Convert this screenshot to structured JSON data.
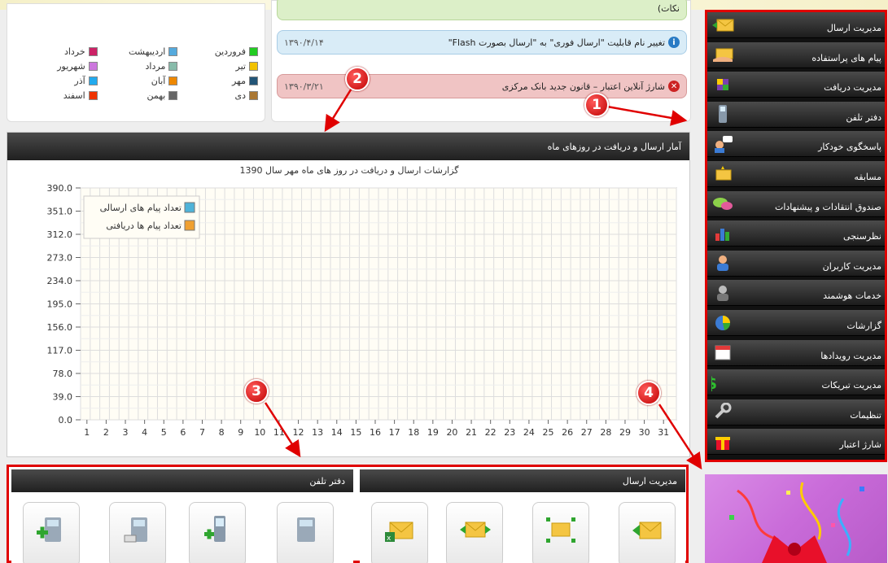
{
  "news": {
    "first_partial": "نکات)",
    "item1_text": "تغییر نام قابلیت \"ارسال فوری\" به \"ارسال بصورت Flash\"",
    "item1_date": "۱۳۹۰/۴/۱۴",
    "item2_text": "شارژ آنلاین اعتبار – قانون جدید بانک مرکزی",
    "item2_date": "۱۳۹۰/۳/۲۱"
  },
  "months": [
    {
      "label": "فروردین",
      "color": "#22cc22"
    },
    {
      "label": "اردیبهشت",
      "color": "#55aadd"
    },
    {
      "label": "خرداد",
      "color": "#cc2266"
    },
    {
      "label": "تیر",
      "color": "#f2c200"
    },
    {
      "label": "مرداد",
      "color": "#88bbaa"
    },
    {
      "label": "شهریور",
      "color": "#cc77dd"
    },
    {
      "label": "مهر",
      "color": "#225577"
    },
    {
      "label": "آبان",
      "color": "#ee8800"
    },
    {
      "label": "آذر",
      "color": "#22aaee"
    },
    {
      "label": "دی",
      "color": "#aa7733"
    },
    {
      "label": "بهمن",
      "color": "#666666"
    },
    {
      "label": "اسفند",
      "color": "#ee3300"
    }
  ],
  "chart_panel": {
    "header": "آمار ارسال و دریافت در روزهای ماه"
  },
  "chart_data": {
    "type": "line",
    "title": "گزارشات ارسال و دریافت در روز های ماه مهر سال 1390",
    "x": [
      1,
      2,
      3,
      4,
      5,
      6,
      7,
      8,
      9,
      10,
      11,
      12,
      13,
      14,
      15,
      16,
      17,
      18,
      19,
      20,
      21,
      22,
      23,
      24,
      25,
      26,
      27,
      28,
      29,
      30,
      31
    ],
    "y_ticks": [
      "0.0",
      "39.0",
      "78.0",
      "117.0",
      "156.0",
      "195.0",
      "234.0",
      "273.0",
      "312.0",
      "351.0",
      "390.0"
    ],
    "ylim": [
      0,
      390
    ],
    "series": [
      {
        "name": "تعداد پیام های ارسالی",
        "color": "#4fb3d9",
        "values": []
      },
      {
        "name": "تعداد پیام ها دریافتی",
        "color": "#f0a030",
        "values": []
      }
    ],
    "grid": true,
    "legend_position": "top-left"
  },
  "bottom": {
    "left_header": "دفتر تلفن",
    "right_header": "مدیریت ارسال"
  },
  "sidebar": {
    "items": [
      {
        "label": "مدیریت ارسال",
        "icon": "envelope-arrow-icon"
      },
      {
        "label": "پیام های پراستفاده",
        "icon": "envelope-hand-icon"
      },
      {
        "label": "مدیریت دریافت",
        "icon": "cube-icon"
      },
      {
        "label": "دفتر تلفن",
        "icon": "phone-icon"
      },
      {
        "label": "پاسخگوی خودکار",
        "icon": "chat-user-icon"
      },
      {
        "label": "مسابقه",
        "icon": "envelope-burst-icon"
      },
      {
        "label": "صندوق انتقادات و پیشنهادات",
        "icon": "speech-bubbles-icon"
      },
      {
        "label": "نظرسنجی",
        "icon": "bar-chart-icon"
      },
      {
        "label": "مدیریت کاربران",
        "icon": "user-icon"
      },
      {
        "label": "خدمات هوشمند",
        "icon": "agent-icon"
      },
      {
        "label": "گزارشات",
        "icon": "pie-chart-icon"
      },
      {
        "label": "مدیریت رویدادها",
        "icon": "calendar-icon"
      },
      {
        "label": "مدیریت تبریکات",
        "icon": "dollar-icon"
      },
      {
        "label": "تنظیمات",
        "icon": "wrench-icon"
      },
      {
        "label": "شارژ اعتبار",
        "icon": "gift-icon"
      }
    ]
  },
  "annotations": [
    "1",
    "2",
    "3",
    "4"
  ]
}
